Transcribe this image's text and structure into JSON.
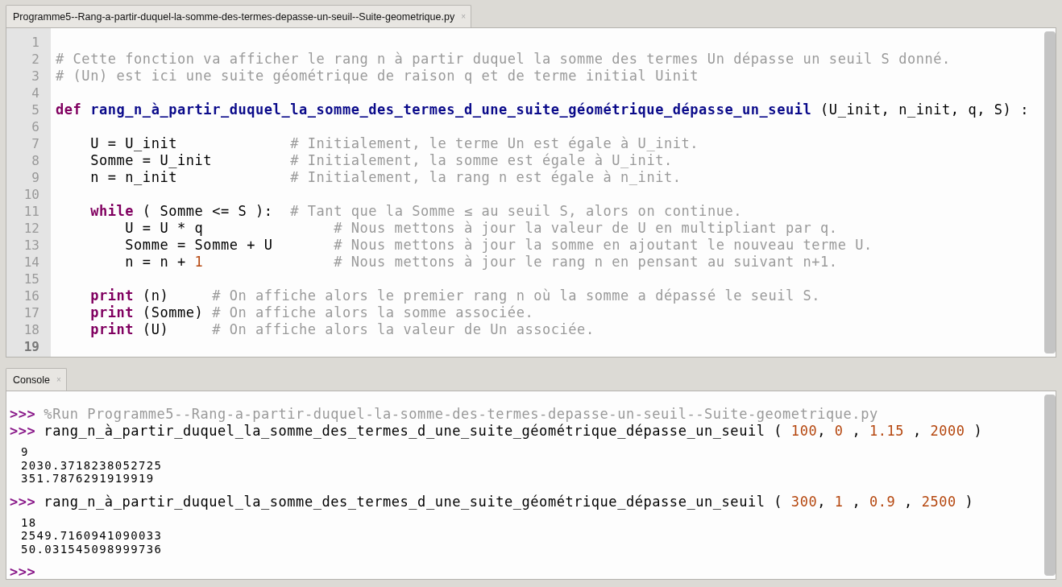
{
  "editor": {
    "tab": {
      "label": "Programme5--Rang-a-partir-duquel-la-somme-des-termes-depasse-un-seuil--Suite-geometrique.py",
      "close": "×"
    },
    "lines": [
      {
        "number": "1",
        "current": false
      },
      {
        "number": "2",
        "current": false,
        "tokens": [
          {
            "kind": "comment",
            "text": "# Cette fonction va afficher le rang n à partir duquel la somme des termes Un dépasse un seuil S donné."
          }
        ]
      },
      {
        "number": "3",
        "current": false,
        "tokens": [
          {
            "kind": "comment",
            "text": "# (Un) est ici une suite géométrique de raison q et de terme initial Uinit"
          }
        ]
      },
      {
        "number": "4",
        "current": false
      },
      {
        "number": "5",
        "current": false,
        "tokens": [
          {
            "kind": "keyword",
            "text": "def "
          },
          {
            "kind": "function",
            "text": "rang_n_à_partir_duquel_la_somme_des_termes_d_une_suite_géométrique_dépasse_un_seuil"
          },
          {
            "kind": "plain",
            "text": " (U_init, n_init, q, S) :"
          }
        ]
      },
      {
        "number": "6",
        "current": false
      },
      {
        "number": "7",
        "current": false,
        "tokens": [
          {
            "kind": "plain",
            "text": "    U = U_init             "
          },
          {
            "kind": "comment",
            "text": "# Initialement, le terme Un est égale à U_init."
          }
        ]
      },
      {
        "number": "8",
        "current": false,
        "tokens": [
          {
            "kind": "plain",
            "text": "    Somme = U_init         "
          },
          {
            "kind": "comment",
            "text": "# Initialement, la somme est égale à U_init."
          }
        ]
      },
      {
        "number": "9",
        "current": false,
        "tokens": [
          {
            "kind": "plain",
            "text": "    n = n_init             "
          },
          {
            "kind": "comment",
            "text": "# Initialement, la rang n est égale à n_init."
          }
        ]
      },
      {
        "number": "10",
        "current": false
      },
      {
        "number": "11",
        "current": false,
        "tokens": [
          {
            "kind": "keyword",
            "text": "    while"
          },
          {
            "kind": "plain",
            "text": " ( Somme <= S ):  "
          },
          {
            "kind": "comment",
            "text": "# Tant que la Somme ≤ au seuil S, alors on continue."
          }
        ]
      },
      {
        "number": "12",
        "current": false,
        "tokens": [
          {
            "kind": "plain",
            "text": "        U = U * q               "
          },
          {
            "kind": "comment",
            "text": "# Nous mettons à jour la valeur de U en multipliant par q."
          }
        ]
      },
      {
        "number": "13",
        "current": false,
        "tokens": [
          {
            "kind": "plain",
            "text": "        Somme = Somme + U       "
          },
          {
            "kind": "comment",
            "text": "# Nous mettons à jour la somme en ajoutant le nouveau terme U."
          }
        ]
      },
      {
        "number": "14",
        "current": false,
        "tokens": [
          {
            "kind": "plain",
            "text": "        n = n + "
          },
          {
            "kind": "number",
            "text": "1"
          },
          {
            "kind": "comment",
            "text": "               # Nous mettons à jour le rang n en pensant au suivant n+1."
          }
        ]
      },
      {
        "number": "15",
        "current": false
      },
      {
        "number": "16",
        "current": false,
        "tokens": [
          {
            "kind": "keyword",
            "text": "    print"
          },
          {
            "kind": "plain",
            "text": " (n)     "
          },
          {
            "kind": "comment",
            "text": "# On affiche alors le premier rang n où la somme a dépassé le seuil S."
          }
        ]
      },
      {
        "number": "17",
        "current": false,
        "tokens": [
          {
            "kind": "keyword",
            "text": "    print"
          },
          {
            "kind": "plain",
            "text": " (Somme) "
          },
          {
            "kind": "comment",
            "text": "# On affiche alors la somme associée."
          }
        ]
      },
      {
        "number": "18",
        "current": false,
        "tokens": [
          {
            "kind": "keyword",
            "text": "    print"
          },
          {
            "kind": "plain",
            "text": " (U)     "
          },
          {
            "kind": "comment",
            "text": "# On affiche alors la valeur de Un associée."
          }
        ]
      },
      {
        "number": "19",
        "current": true
      }
    ]
  },
  "console": {
    "tab": {
      "label": "Console",
      "close": "×"
    },
    "lines": [
      {
        "kind": "input",
        "prompt": ">>>",
        "tokens": [
          {
            "kind": "comment",
            "text": "%Run Programme5--Rang-a-partir-duquel-la-somme-des-termes-depasse-un-seuil--Suite-geometrique.py"
          }
        ]
      },
      {
        "kind": "input",
        "prompt": ">>>",
        "tokens": [
          {
            "kind": "plain",
            "text": "rang_n_à_partir_duquel_la_somme_des_termes_d_une_suite_géométrique_dépasse_un_seuil ( "
          },
          {
            "kind": "number",
            "text": "100"
          },
          {
            "kind": "plain",
            "text": ", "
          },
          {
            "kind": "number",
            "text": "0"
          },
          {
            "kind": "plain",
            "text": " , "
          },
          {
            "kind": "number",
            "text": "1.15"
          },
          {
            "kind": "plain",
            "text": " , "
          },
          {
            "kind": "number",
            "text": "2000"
          },
          {
            "kind": "plain",
            "text": " )"
          }
        ]
      },
      {
        "kind": "output",
        "text": "9"
      },
      {
        "kind": "output",
        "text": "2030.3718238052725"
      },
      {
        "kind": "output",
        "text": "351.7876291919919"
      },
      {
        "kind": "input",
        "prompt": ">>>",
        "tokens": [
          {
            "kind": "plain",
            "text": "rang_n_à_partir_duquel_la_somme_des_termes_d_une_suite_géométrique_dépasse_un_seuil ( "
          },
          {
            "kind": "number",
            "text": "300"
          },
          {
            "kind": "plain",
            "text": ", "
          },
          {
            "kind": "number",
            "text": "1"
          },
          {
            "kind": "plain",
            "text": " , "
          },
          {
            "kind": "number",
            "text": "0.9"
          },
          {
            "kind": "plain",
            "text": " , "
          },
          {
            "kind": "number",
            "text": "2500"
          },
          {
            "kind": "plain",
            "text": " )"
          }
        ]
      },
      {
        "kind": "output",
        "text": "18"
      },
      {
        "kind": "output",
        "text": "2549.7160941090033"
      },
      {
        "kind": "output",
        "text": "50.031545098999736"
      },
      {
        "kind": "input",
        "prompt": ">>>"
      }
    ]
  }
}
